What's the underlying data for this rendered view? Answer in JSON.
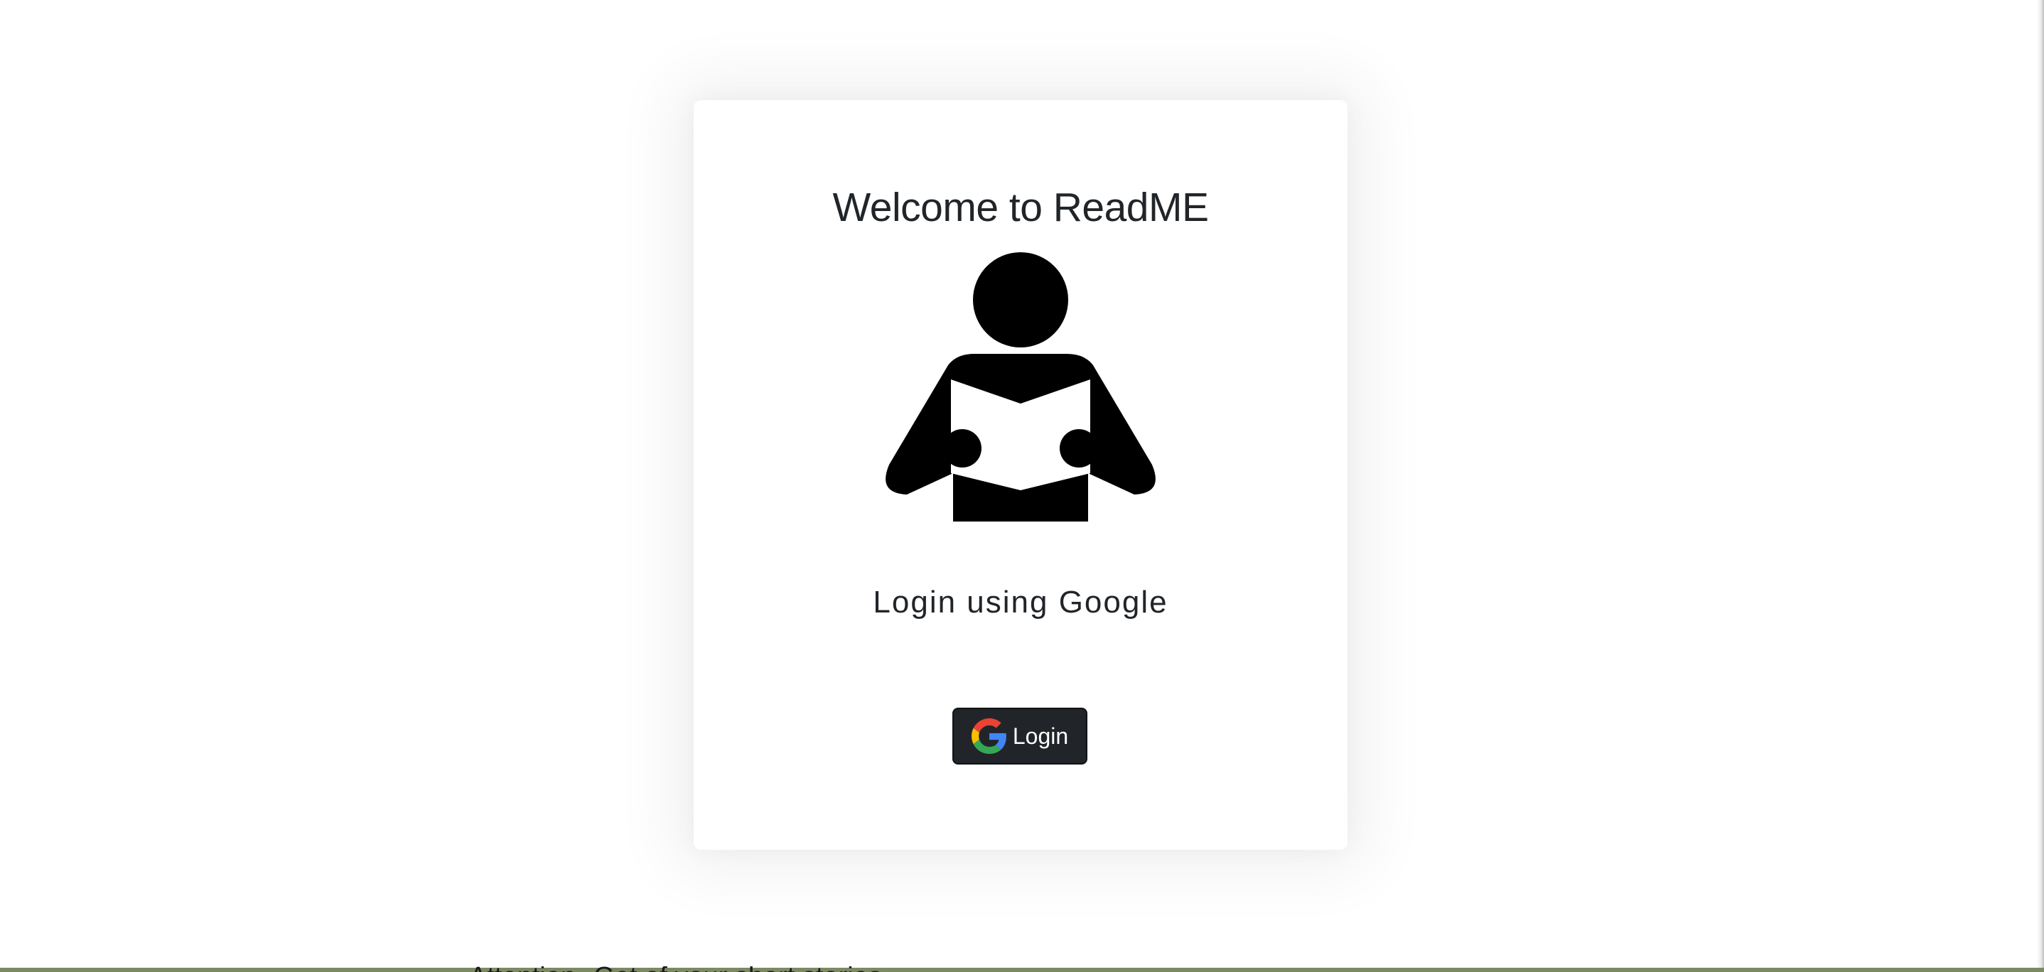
{
  "card": {
    "title": "Welcome to ReadME",
    "illustration": "person-reading-icon",
    "subtitle": "Login using Google"
  },
  "login_button": {
    "label": "Login",
    "icon": "google-icon",
    "background": "#212529",
    "text_color": "#ffffff"
  },
  "background_peek_text": "Attention--Get of your short stories"
}
